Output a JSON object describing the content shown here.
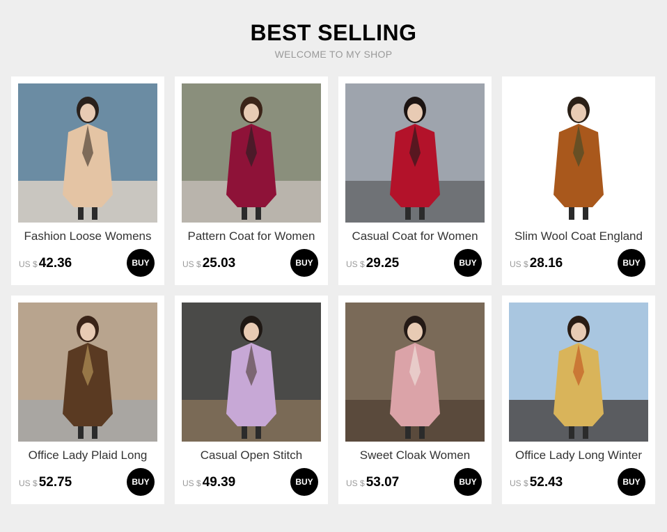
{
  "header": {
    "title": "BEST SELLING",
    "subtitle": "WELCOME TO MY SHOP"
  },
  "products": [
    {
      "name": "Fashion Loose Womens",
      "currency": "US $",
      "price": "42.36",
      "buy_label": "BUY",
      "photo": {
        "bg": "#6b8ca3",
        "ground": "#c9c6c0",
        "coat": "#e4c4a4",
        "accent": "#3a3028",
        "hair": "#2a211c"
      }
    },
    {
      "name": "Pattern Coat for Women",
      "currency": "US $",
      "price": "25.03",
      "buy_label": "BUY",
      "photo": {
        "bg": "#8a8f7c",
        "ground": "#b9b4ac",
        "coat": "#8e1238",
        "accent": "#1f1f1f",
        "hair": "#3b2418"
      }
    },
    {
      "name": "Casual Coat for Women",
      "currency": "US $",
      "price": "29.25",
      "buy_label": "BUY",
      "photo": {
        "bg": "#9ea4ad",
        "ground": "#6f7276",
        "coat": "#b3122a",
        "accent": "#1a1a1a",
        "hair": "#1c1412"
      }
    },
    {
      "name": "Slim Wool Coat England",
      "currency": "US $",
      "price": "28.16",
      "buy_label": "BUY",
      "photo": {
        "bg": "#ffffff",
        "ground": "#ffffff",
        "coat": "#a9581c",
        "accent": "#3c4a2a",
        "hair": "#2a1f16"
      }
    },
    {
      "name": "Office Lady Plaid Long",
      "currency": "US $",
      "price": "52.75",
      "buy_label": "BUY",
      "photo": {
        "bg": "#b8a48e",
        "ground": "#a9a6a2",
        "coat": "#5a3a22",
        "accent": "#c0a060",
        "hair": "#3a2418"
      }
    },
    {
      "name": "Casual Open Stitch",
      "currency": "US $",
      "price": "49.39",
      "buy_label": "BUY",
      "photo": {
        "bg": "#4a4a48",
        "ground": "#7a6a56",
        "coat": "#c7a8d6",
        "accent": "#4a3a30",
        "hair": "#1f1814"
      }
    },
    {
      "name": "Sweet Cloak Women",
      "currency": "US $",
      "price": "53.07",
      "buy_label": "BUY",
      "photo": {
        "bg": "#7a6a58",
        "ground": "#5a4a3c",
        "coat": "#dba3a8",
        "accent": "#f0e6e0",
        "hair": "#241a16"
      }
    },
    {
      "name": "Office Lady Long Winter",
      "currency": "US $",
      "price": "52.43",
      "buy_label": "BUY",
      "photo": {
        "bg": "#a9c6e0",
        "ground": "#5a5c60",
        "coat": "#d9b45a",
        "accent": "#c0501c",
        "hair": "#2a1c14"
      }
    }
  ]
}
